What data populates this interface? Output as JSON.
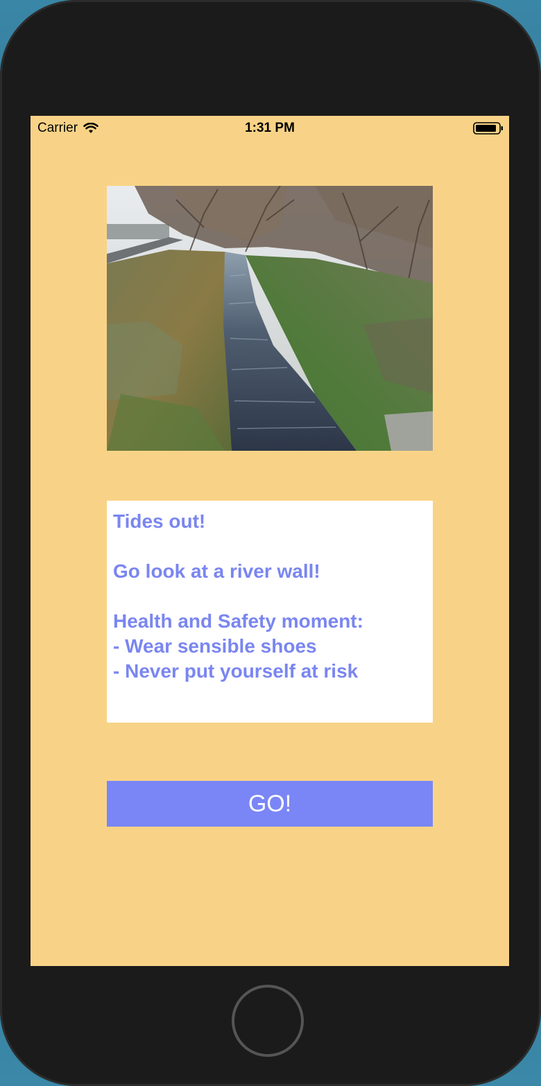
{
  "status_bar": {
    "carrier": "Carrier",
    "time": "1:31 PM"
  },
  "photo": {
    "alt": "River stream between grassy banks with bare trees"
  },
  "message": {
    "lines": [
      "Tides out!",
      "",
      "Go look at a river wall!",
      "",
      "Health and Safety moment:",
      "- Wear sensible shoes",
      "- Never put yourself at risk"
    ]
  },
  "go_button": {
    "label": "GO!"
  },
  "colors": {
    "screen_background": "#f8d387",
    "text_accent": "#7a86f0",
    "button_background": "#7a86f5",
    "device_frame": "#1b1b1b"
  }
}
